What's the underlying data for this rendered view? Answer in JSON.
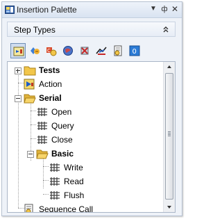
{
  "window": {
    "title": "Insertion Palette"
  },
  "title_buttons": [
    "dropdown-icon",
    "pin-icon",
    "close-icon"
  ],
  "section": {
    "label": "Step Types"
  },
  "toolbar": {
    "tools": [
      "step-types-icon",
      "templates-icon",
      "instrument-icon",
      "globe-icon",
      "tools-icon",
      "signal-icon",
      "sequence-call-icon",
      "number-icon"
    ],
    "selected": 0
  },
  "tree": {
    "items": [
      {
        "label": "Tests",
        "bold": true,
        "icon": "folder-icon",
        "expander": "plus"
      },
      {
        "label": "Action",
        "bold": false,
        "icon": "action-icon"
      },
      {
        "label": "Serial",
        "bold": true,
        "icon": "folder-open-icon",
        "expander": "minus"
      },
      {
        "label": "Open",
        "bold": false,
        "icon": "serial-step-icon"
      },
      {
        "label": "Query",
        "bold": false,
        "icon": "serial-step-icon"
      },
      {
        "label": "Close",
        "bold": false,
        "icon": "serial-step-icon"
      },
      {
        "label": "Basic",
        "bold": true,
        "icon": "folder-open-icon",
        "expander": "minus"
      },
      {
        "label": "Write",
        "bold": false,
        "icon": "serial-step-icon"
      },
      {
        "label": "Read",
        "bold": false,
        "icon": "serial-step-icon"
      },
      {
        "label": "Flush",
        "bold": false,
        "icon": "serial-step-icon"
      },
      {
        "label": "Sequence Call",
        "bold": false,
        "icon": "sequence-call-icon"
      }
    ]
  },
  "colors": {
    "folder": "#f2c64a",
    "accent": "#3a6db5",
    "selection": "#cfdcee"
  }
}
